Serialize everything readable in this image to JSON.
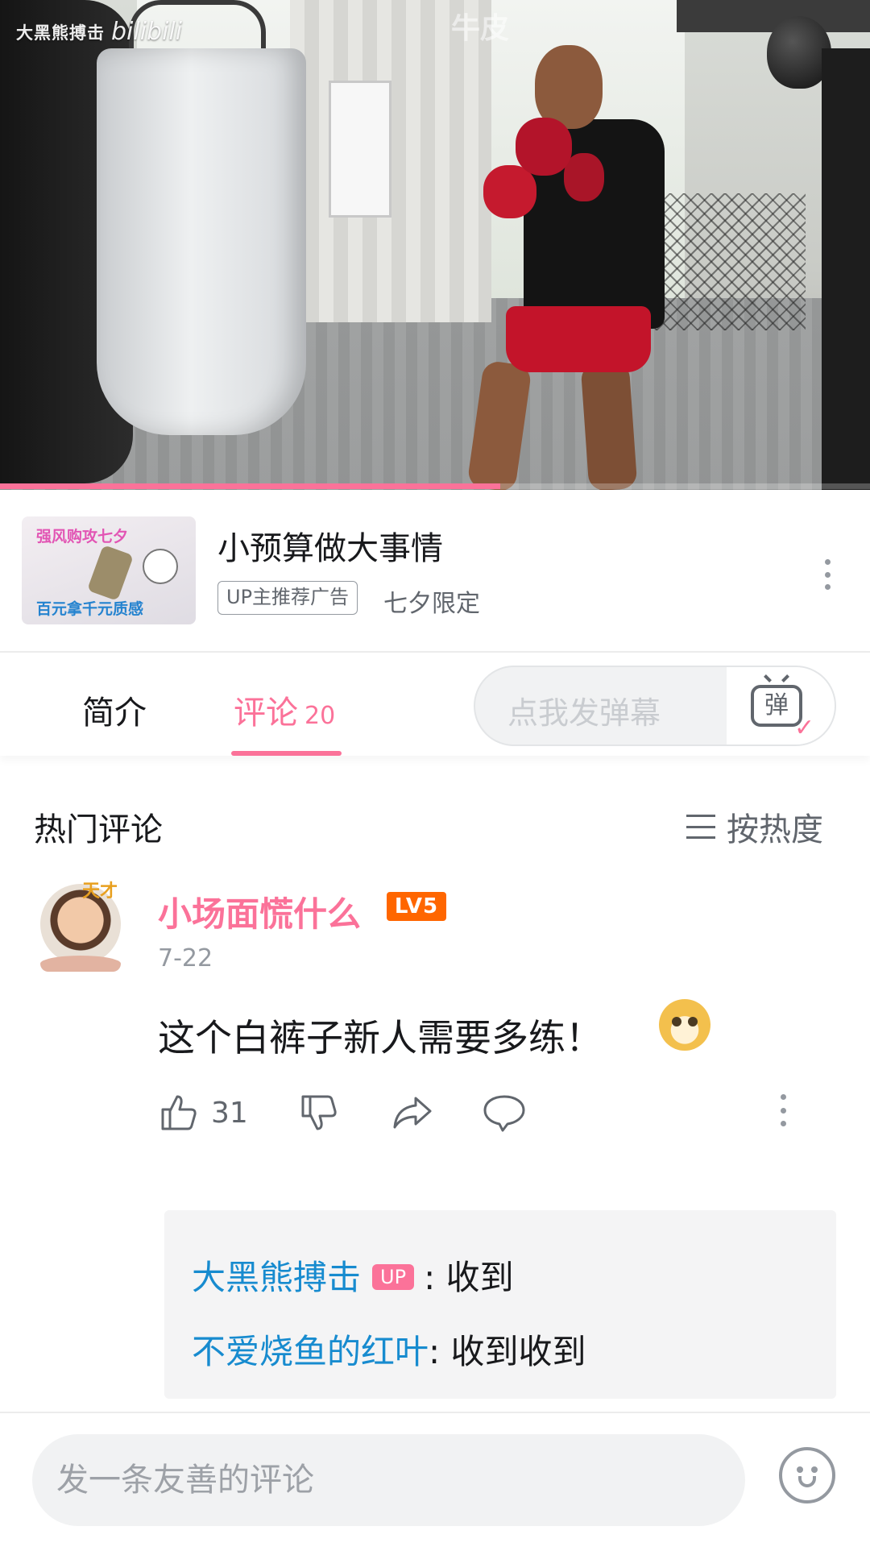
{
  "video": {
    "watermark_channel": "大黑熊搏击",
    "watermark_logo": "bilibili",
    "danmaku_overlay": "牛皮",
    "progress_fraction": 0.575
  },
  "ad": {
    "thumb_top_text": "强风购攻七夕",
    "thumb_bottom_text": "百元拿千元质感",
    "title": "小预算做大事情",
    "tag": "UP主推荐广告",
    "subtitle": "七夕限定"
  },
  "tabs": {
    "intro_label": "简介",
    "comments_label": "评论",
    "comments_count": "20",
    "danmaku_placeholder": "点我发弹幕",
    "danmaku_button_glyph": "弹"
  },
  "comments": {
    "section_title": "热门评论",
    "sort_label": "按热度",
    "items": [
      {
        "avatar_badge": "天才",
        "username": "小场面慌什么",
        "level": "LV5",
        "date": "7-22",
        "text": "这个白裤子新人需要多练！",
        "likes": "31",
        "replies": [
          {
            "name": "大黑熊搏击",
            "badge": "UP",
            "text": ": 收到"
          },
          {
            "name": "不爱烧鱼的红叶",
            "text": ": 收到收到"
          }
        ]
      }
    ]
  },
  "bottom": {
    "comment_placeholder": "发一条友善的评论"
  },
  "colors": {
    "accent_pink": "#fb7299",
    "link_blue": "#178bcf",
    "level_orange": "#ff6600"
  }
}
